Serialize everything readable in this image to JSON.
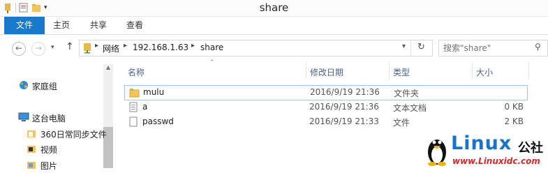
{
  "window": {
    "title": "share"
  },
  "ribbon": {
    "tabs": [
      "文件",
      "主页",
      "共享",
      "查看"
    ]
  },
  "address": {
    "crumbs": [
      "网络",
      "192.168.1.63",
      "share"
    ],
    "search_placeholder": "搜索\"share\""
  },
  "nav": {
    "items": [
      {
        "label": "家庭组",
        "icon": "homegroup-icon"
      },
      {
        "label": "这台电脑",
        "icon": "computer-icon"
      },
      {
        "label": "360日常同步文件",
        "icon": "folder-icon"
      },
      {
        "label": "视频",
        "icon": "video-folder-icon"
      },
      {
        "label": "图片",
        "icon": "picture-folder-icon"
      }
    ]
  },
  "files": {
    "columns": {
      "name": "名称",
      "date": "修改日期",
      "type": "类型",
      "size": "大小"
    },
    "rows": [
      {
        "name": "mulu",
        "date": "2016/9/19 21:36",
        "type": "文件夹",
        "size": "",
        "icon": "folder-icon"
      },
      {
        "name": "a",
        "date": "2016/9/19 21:36",
        "type": "文本文档",
        "size": "0 KB",
        "icon": "text-file-icon"
      },
      {
        "name": "passwd",
        "date": "2016/9/19 21:33",
        "type": "文件",
        "size": "2 KB",
        "icon": "file-icon"
      }
    ]
  },
  "watermark": {
    "brand": "Linux",
    "suffix": "公社",
    "url": "www.Linuxidc.com"
  },
  "colors": {
    "accent": "#1979ca",
    "header_text": "#4d6082",
    "selection_border": "#99c8f5",
    "watermark_blue": "#1a73c8"
  }
}
